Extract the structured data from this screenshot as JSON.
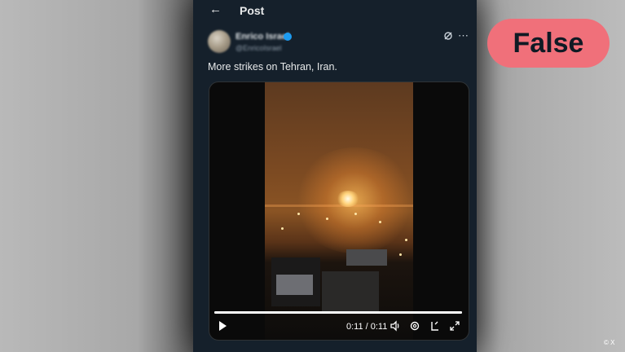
{
  "header": {
    "back_icon": "arrow-left-icon",
    "title": "Post"
  },
  "post": {
    "author_name": "Enrico Israel",
    "author_handle": "@EnricoIsrael",
    "text": "More strikes on Tehran, Iran."
  },
  "video": {
    "time_display": "0:11 / 0:11",
    "progress": 1.0,
    "controls": [
      "play-icon",
      "volume-icon",
      "settings-icon",
      "captions-icon",
      "fullscreen-icon"
    ]
  },
  "badge": {
    "label": "False",
    "color": "#f0707a"
  },
  "credit": "© X",
  "colors": {
    "panel_bg": "#15202b",
    "verified": "#1d9bf0"
  }
}
